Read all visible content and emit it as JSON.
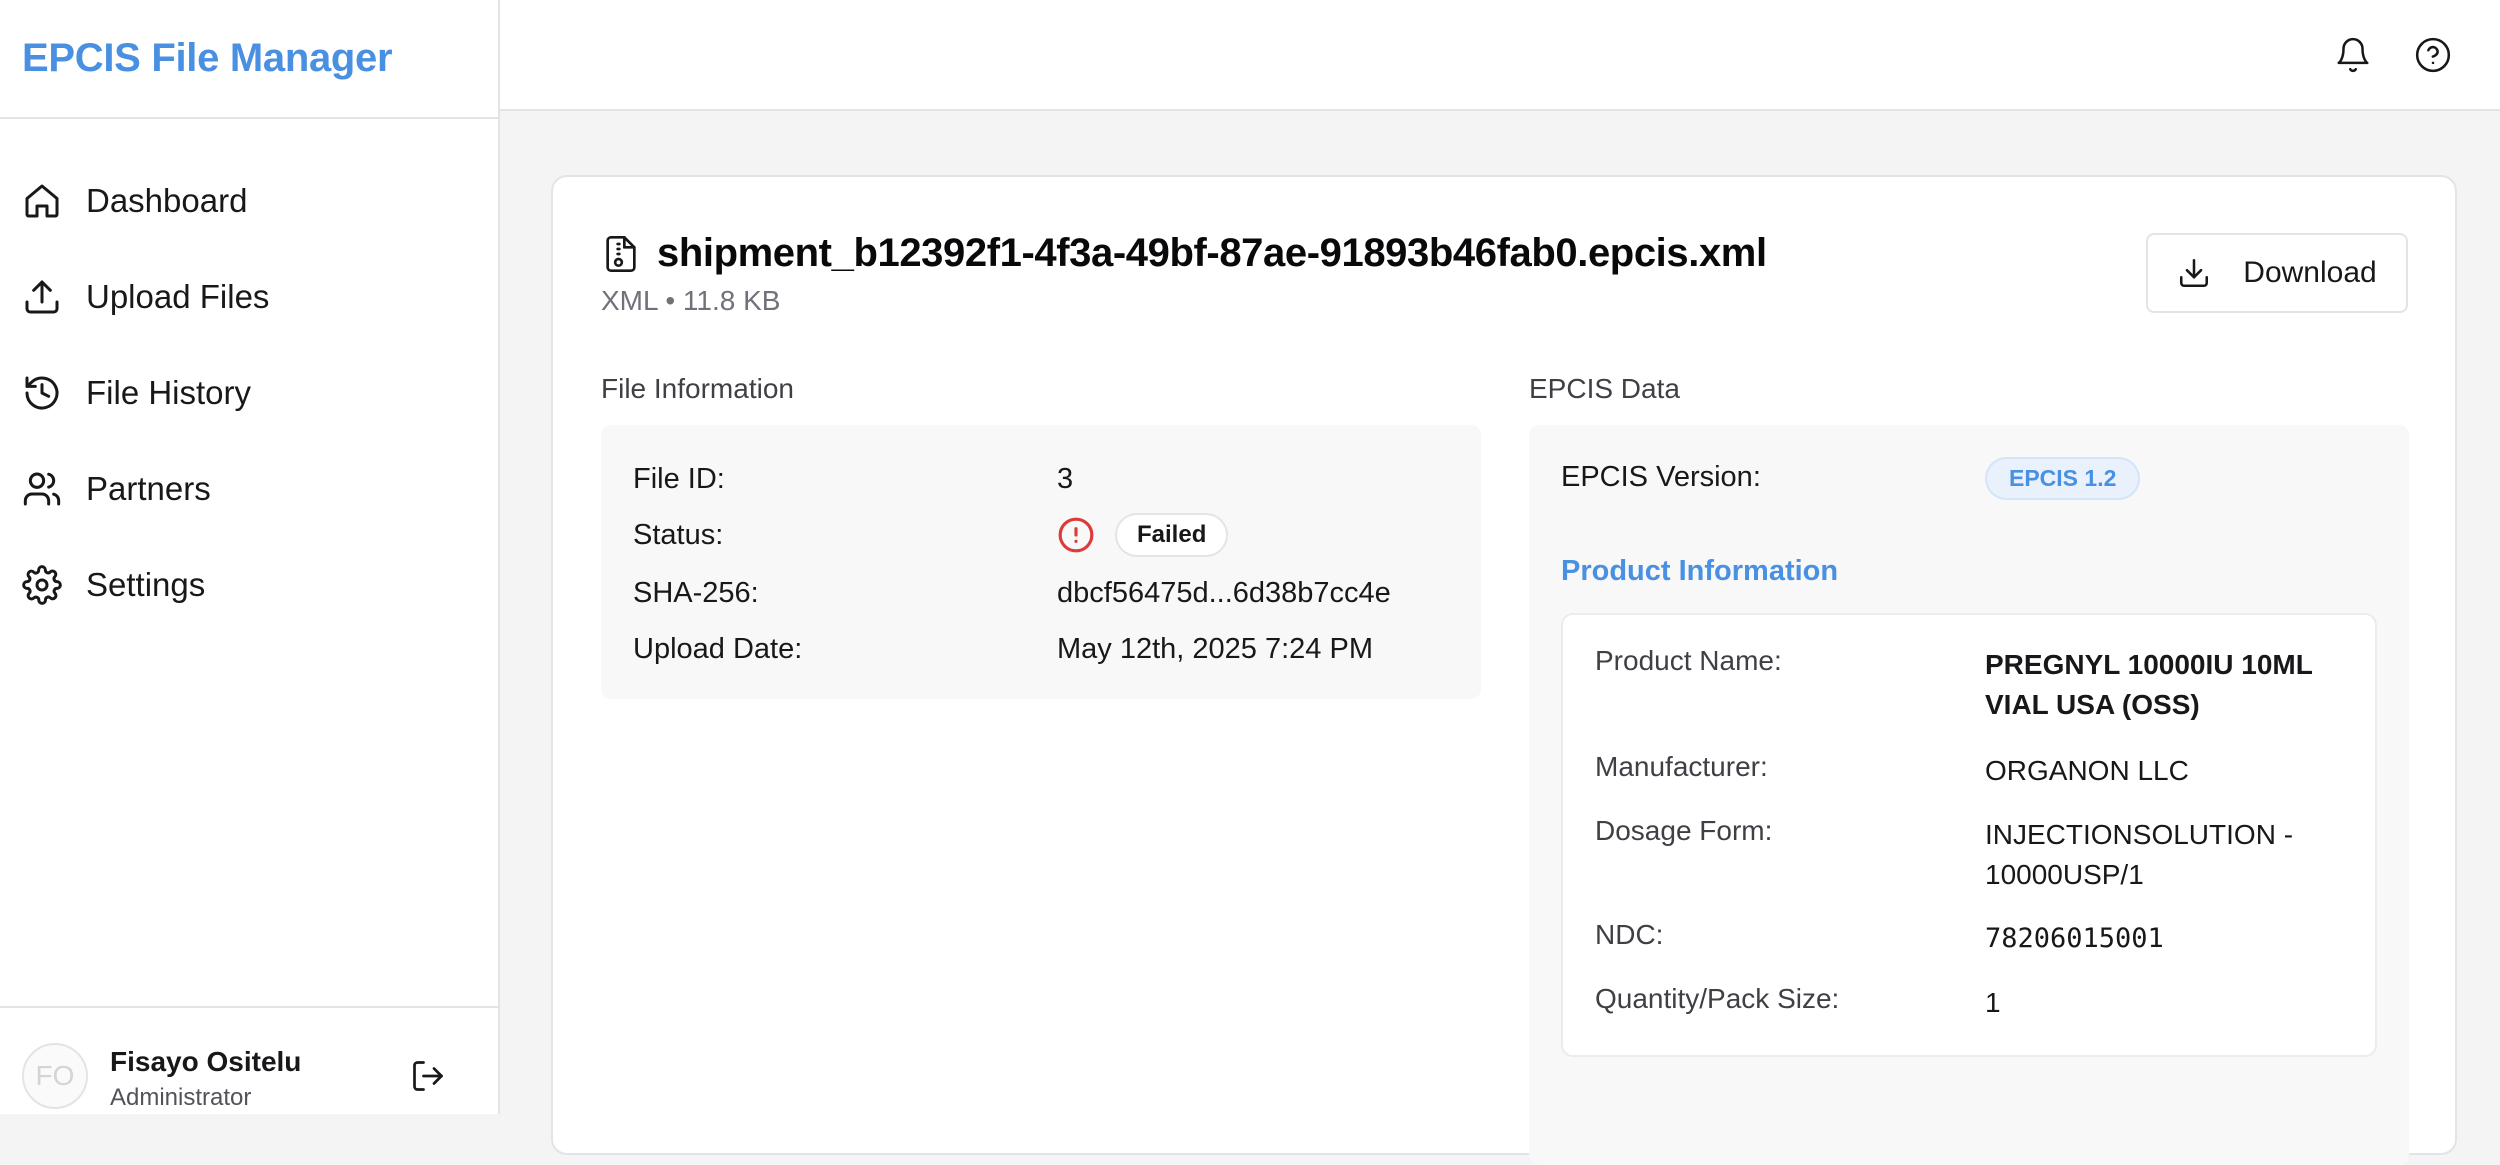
{
  "app": {
    "title": "EPCIS File Manager"
  },
  "sidebar": {
    "items": [
      {
        "label": "Dashboard",
        "icon": "home-icon"
      },
      {
        "label": "Upload Files",
        "icon": "upload-icon"
      },
      {
        "label": "File History",
        "icon": "history-icon"
      },
      {
        "label": "Partners",
        "icon": "users-icon"
      },
      {
        "label": "Settings",
        "icon": "gear-icon"
      }
    ],
    "user": {
      "initials": "FO",
      "name": "Fisayo Ositelu",
      "role": "Administrator"
    }
  },
  "header": {
    "icons": [
      "bell-icon",
      "help-circle-icon"
    ]
  },
  "file": {
    "name": "shipment_b12392f1-4f3a-49bf-87ae-91893b46fab0.epcis.xml",
    "meta": "XML • 11.8 KB",
    "download_label": "Download"
  },
  "file_info": {
    "section_title": "File Information",
    "rows": {
      "file_id": {
        "label": "File ID:",
        "value": "3"
      },
      "status": {
        "label": "Status:",
        "value": "Failed"
      },
      "sha": {
        "label": "SHA-256:",
        "value": "dbcf56475d...6d38b7cc4e"
      },
      "upload_date": {
        "label": "Upload Date:",
        "value": "May 12th, 2025 7:24 PM"
      }
    }
  },
  "epcis": {
    "section_title": "EPCIS Data",
    "version_label": "EPCIS Version:",
    "version_value": "EPCIS 1.2",
    "product_heading": "Product Information",
    "product": {
      "name": {
        "label": "Product Name:",
        "value": "PREGNYL 10000IU 10ML VIAL USA (OSS)"
      },
      "manufacturer": {
        "label": "Manufacturer:",
        "value": "ORGANON LLC"
      },
      "dosage": {
        "label": "Dosage Form:",
        "value": "INJECTIONSOLUTION - 10000USP/1"
      },
      "ndc": {
        "label": "NDC:",
        "value": "78206015001"
      },
      "qty": {
        "label": "Quantity/Pack Size:",
        "value": "1"
      }
    }
  },
  "colors": {
    "brand": "#4a90e2",
    "failed": "#dc3b3b",
    "badge_bg": "#e8f1fc"
  }
}
